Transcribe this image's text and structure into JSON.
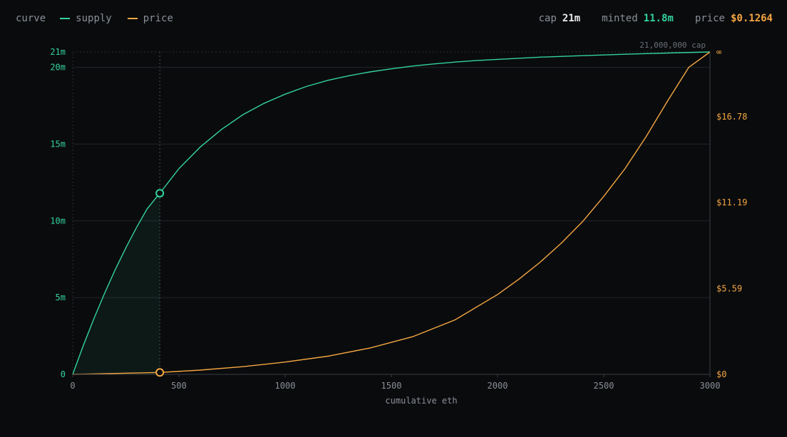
{
  "legend": {
    "label": "curve",
    "items": [
      {
        "name": "supply",
        "color": "#33d39c"
      },
      {
        "name": "price",
        "color": "#f5a742"
      }
    ]
  },
  "stats": {
    "cap": {
      "key": "cap",
      "value": "21m"
    },
    "minted": {
      "key": "minted",
      "value": "11.8m"
    },
    "price": {
      "key": "price",
      "value": "$0.1264"
    }
  },
  "colors": {
    "background": "#0a0b0d",
    "supply": "#33d39c",
    "price": "#f5a742",
    "grid": "#22252a",
    "axis_text": "#8a8f98"
  },
  "chart_data": {
    "type": "line",
    "xlabel": "cumulative eth",
    "xlim": [
      0,
      3000
    ],
    "x_ticks": [
      0,
      500,
      1000,
      1500,
      2000,
      2500,
      3000
    ],
    "y_left": {
      "ticks": [
        {
          "value": 0,
          "label": "0"
        },
        {
          "value": 5000000,
          "label": "5m"
        },
        {
          "value": 10000000,
          "label": "10m"
        },
        {
          "value": 15000000,
          "label": "15m"
        },
        {
          "value": 20000000,
          "label": "20m"
        },
        {
          "value": 21000000,
          "label": "21m"
        }
      ],
      "lim": [
        0,
        21000000
      ]
    },
    "y_right": {
      "ticks": [
        {
          "value": 0,
          "label": "$0"
        },
        {
          "value": 5.59,
          "label": "$5.59"
        },
        {
          "value": 11.19,
          "label": "$11.19"
        },
        {
          "value": 16.78,
          "label": "$16.78"
        },
        {
          "value": 21,
          "label": "∞"
        }
      ],
      "lim": [
        0,
        21
      ]
    },
    "cap_annotation": "21,000,000 cap",
    "grid": true,
    "series": [
      {
        "name": "supply",
        "axis": "left",
        "x": [
          0,
          25,
          50,
          100,
          150,
          200,
          250,
          300,
          350,
          410,
          500,
          600,
          700,
          800,
          900,
          1000,
          1100,
          1200,
          1300,
          1400,
          1500,
          1600,
          1700,
          1800,
          1900,
          2000,
          2200,
          2400,
          2600,
          2800,
          3000
        ],
        "y": [
          0,
          950000,
          1880000,
          3640000,
          5280000,
          6820000,
          8240000,
          9560000,
          10780000,
          11800000,
          13400000,
          14800000,
          15950000,
          16900000,
          17650000,
          18250000,
          18750000,
          19150000,
          19450000,
          19700000,
          19900000,
          20080000,
          20220000,
          20340000,
          20440000,
          20520000,
          20660000,
          20760000,
          20850000,
          20930000,
          21000000
        ]
      },
      {
        "name": "price",
        "axis": "right",
        "x": [
          0,
          200,
          410,
          600,
          800,
          1000,
          1200,
          1400,
          1600,
          1800,
          2000,
          2100,
          2200,
          2300,
          2400,
          2500,
          2600,
          2700,
          2800,
          2900,
          3000
        ],
        "y": [
          0,
          0.06,
          0.1264,
          0.28,
          0.5,
          0.8,
          1.18,
          1.72,
          2.45,
          3.55,
          5.2,
          6.2,
          7.3,
          8.55,
          9.95,
          11.6,
          13.4,
          15.5,
          17.8,
          20.0,
          21.0
        ]
      }
    ],
    "marker": {
      "x": 410,
      "supply": 11800000,
      "price": 0.1264
    }
  }
}
